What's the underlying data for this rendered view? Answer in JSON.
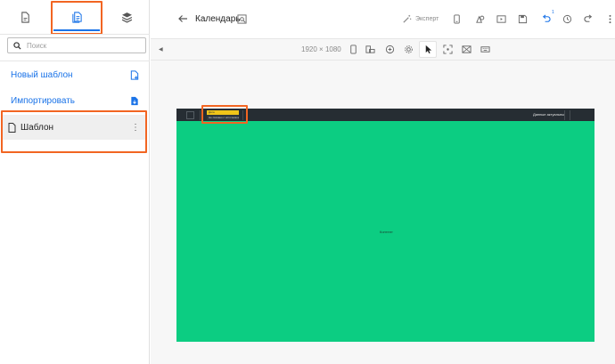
{
  "sidebar": {
    "tabs": [
      {
        "name": "documents"
      },
      {
        "name": "templates",
        "active": true
      },
      {
        "name": "layers"
      }
    ],
    "search": {
      "placeholder": "Поиск",
      "value": ""
    },
    "actions": [
      {
        "label": "Новый шаблон",
        "icon": "file-add-icon"
      },
      {
        "label": "Импортировать",
        "icon": "file-import-icon"
      }
    ],
    "templates": [
      {
        "label": "Шаблон",
        "icon": "document-icon",
        "selected": true
      }
    ]
  },
  "header": {
    "title": "Календарь",
    "expert_label": "Эксперт",
    "undo_badge": "1"
  },
  "toolbar": {
    "width": "1920",
    "times": "×",
    "height": "1080"
  },
  "canvas": {
    "widget_title": "Дата",
    "widget_sub": "Не связано с источником",
    "bar_right": "Данные актуальны",
    "content_label": "Контент"
  },
  "colors": {
    "accent": "#1a73e8",
    "annotation": "#f26522",
    "canvas_bg": "#0ccd82",
    "canvas_bar": "#262d33",
    "widget_yellow": "#f0c419"
  }
}
